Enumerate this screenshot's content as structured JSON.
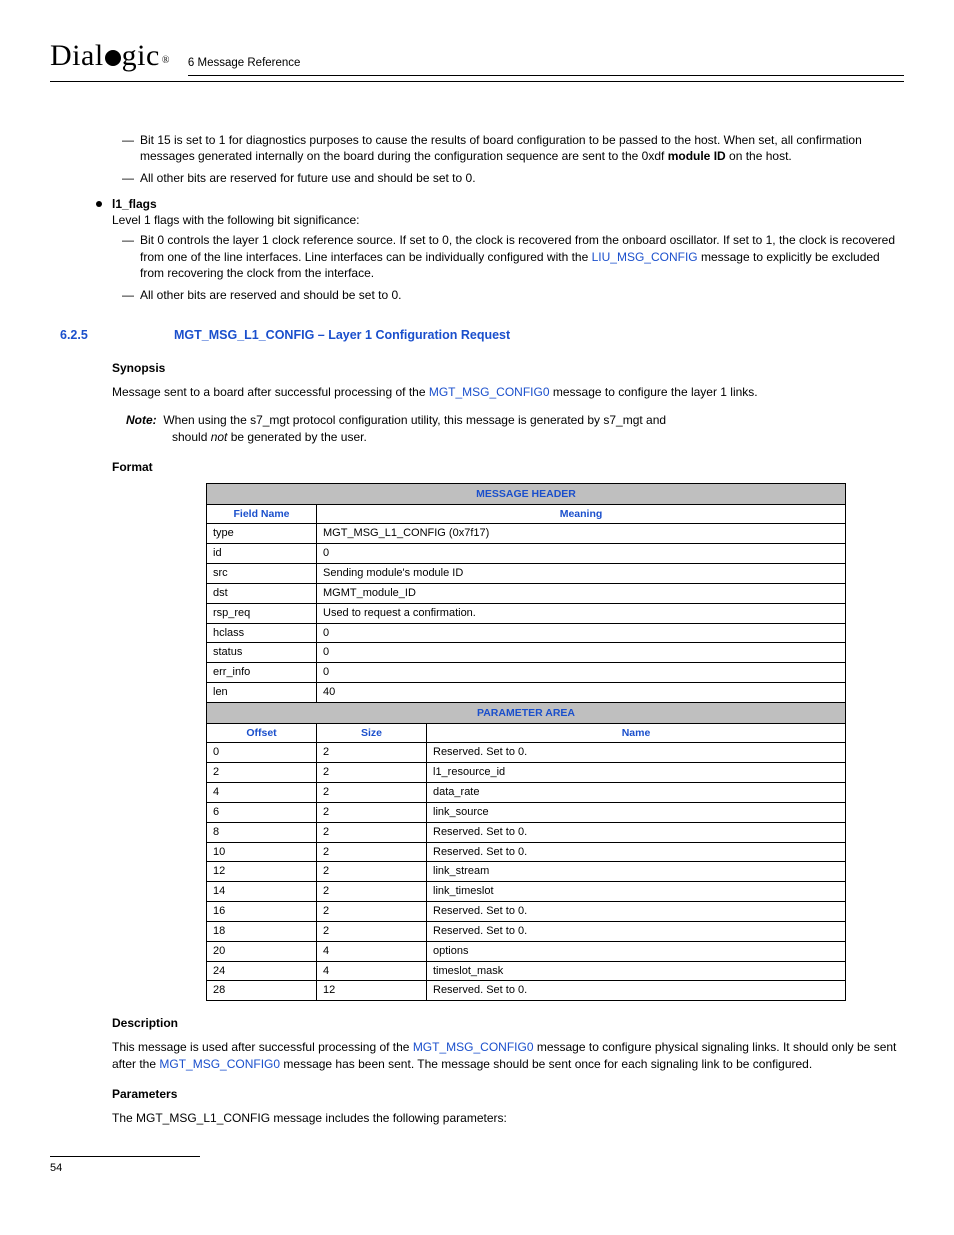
{
  "header": {
    "logo": "Dialogic",
    "chapter": "6 Message Reference"
  },
  "top_list": {
    "d1": "Bit 15 is set to 1 for diagnostics purposes to cause the results of board configuration to be passed to the host. When set, all confirmation messages generated internally on the board during the configuration sequence are sent to the 0xdf ",
    "d1b": "module ID",
    "d1c": " on the host.",
    "d2": "All other bits are reserved for future use and should be set to 0.",
    "b1_label": "l1_flags",
    "b1_desc": "Level 1 flags with the following bit significance:",
    "b1_d1a": "Bit 0 controls the layer 1 clock reference source. If set to 0, the clock is recovered from the onboard oscillator. If set to 1, the clock is recovered from one of the line interfaces. Line interfaces can be individually configured with the ",
    "b1_d1_link": "LIU_MSG_CONFIG",
    "b1_d1b": " message to explicitly be excluded from recovering the clock from the interface.",
    "b1_d2": "All other bits are reserved and should be set to 0."
  },
  "section": {
    "num": "6.2.5",
    "title": "MGT_MSG_L1_CONFIG – Layer 1 Configuration Request"
  },
  "synopsis": {
    "head": "Synopsis",
    "text_a": "Message sent to a board after successful processing of the ",
    "link": "MGT_MSG_CONFIG0",
    "text_b": " message to configure the layer 1 links."
  },
  "note": {
    "label": "Note:",
    "l1": "When using the s7_mgt protocol configuration utility, this message is generated by s7_mgt and",
    "l2a": "should ",
    "l2em": "not",
    "l2b": " be generated by the user."
  },
  "format_head": "Format",
  "table": {
    "band1": "MESSAGE HEADER",
    "hcol1": "Field Name",
    "hcol2": "Meaning",
    "hdr_rows": [
      {
        "f": "type",
        "m": "MGT_MSG_L1_CONFIG (0x7f17)"
      },
      {
        "f": "id",
        "m": "0"
      },
      {
        "f": "src",
        "m": "Sending module's module ID"
      },
      {
        "f": "dst",
        "m": "MGMT_module_ID"
      },
      {
        "f": "rsp_req",
        "m": "Used to request a confirmation."
      },
      {
        "f": "hclass",
        "m": "0"
      },
      {
        "f": "status",
        "m": "0"
      },
      {
        "f": "err_info",
        "m": "0"
      },
      {
        "f": "len",
        "m": "40"
      }
    ],
    "band2": "PARAMETER AREA",
    "pcol1": "Offset",
    "pcol2": "Size",
    "pcol3": "Name",
    "param_rows": [
      {
        "o": "0",
        "s": "2",
        "n": "Reserved. Set to 0."
      },
      {
        "o": "2",
        "s": "2",
        "n": "l1_resource_id"
      },
      {
        "o": "4",
        "s": "2",
        "n": "data_rate"
      },
      {
        "o": "6",
        "s": "2",
        "n": "link_source"
      },
      {
        "o": "8",
        "s": "2",
        "n": "Reserved. Set to 0."
      },
      {
        "o": "10",
        "s": "2",
        "n": "Reserved. Set to 0."
      },
      {
        "o": "12",
        "s": "2",
        "n": "link_stream"
      },
      {
        "o": "14",
        "s": "2",
        "n": "link_timeslot"
      },
      {
        "o": "16",
        "s": "2",
        "n": "Reserved. Set to 0."
      },
      {
        "o": "18",
        "s": "2",
        "n": "Reserved. Set to 0."
      },
      {
        "o": "20",
        "s": "4",
        "n": "options"
      },
      {
        "o": "24",
        "s": "4",
        "n": "timeslot_mask"
      },
      {
        "o": "28",
        "s": "12",
        "n": "Reserved. Set to 0."
      }
    ]
  },
  "description": {
    "head": "Description",
    "a": "This message is used after successful processing of the ",
    "link1": "MGT_MSG_CONFIG0",
    "b": " message to configure physical signaling links. It should only be sent after the ",
    "link2": "MGT_MSG_CONFIG0",
    "c": " message has been sent. The message should be sent once for each signaling link to be configured."
  },
  "params": {
    "head": "Parameters",
    "text": "The MGT_MSG_L1_CONFIG message includes the following parameters:"
  },
  "footer": {
    "page": "54"
  }
}
